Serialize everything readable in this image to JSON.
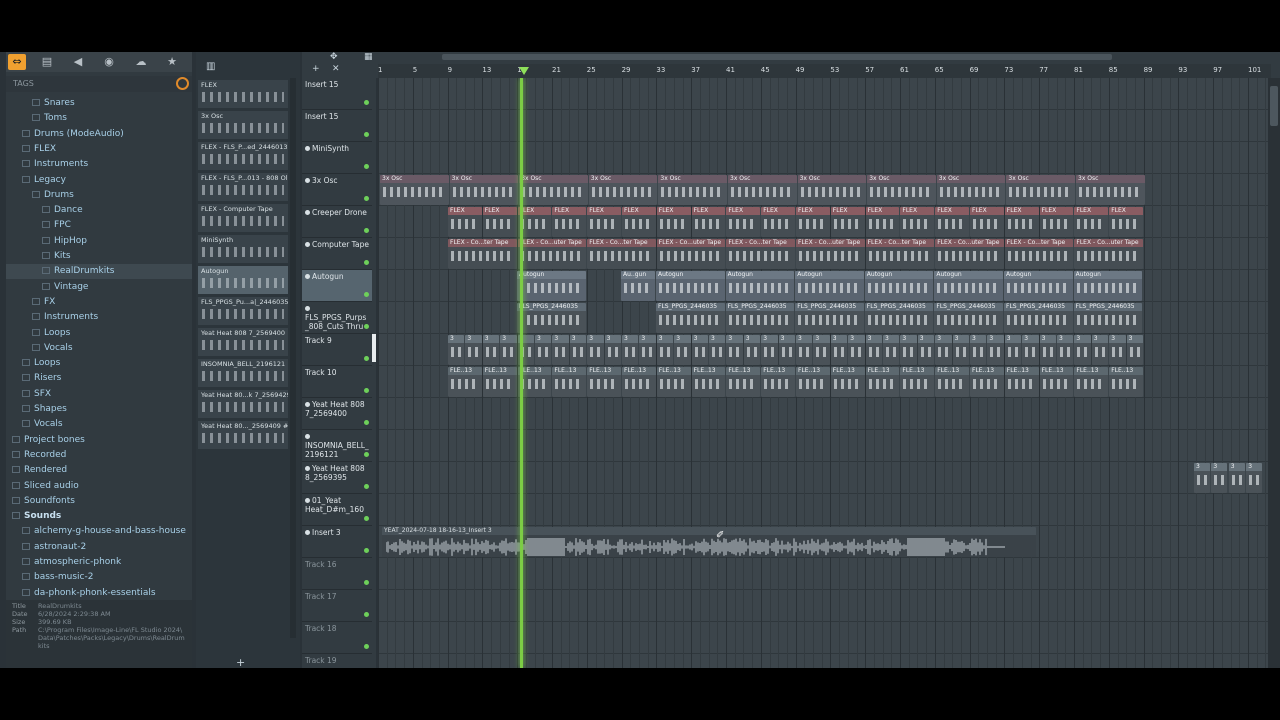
{
  "browser": {
    "toolbar_icons": [
      "arrows-icon",
      "file-icon",
      "speaker-icon",
      "plugin-icon",
      "cloud-icon",
      "star-icon"
    ],
    "tags_label": "TAGS",
    "tree": [
      {
        "label": "Snares",
        "indent": 2
      },
      {
        "label": "Toms",
        "indent": 2
      },
      {
        "label": "Drums (ModeAudio)",
        "indent": 1
      },
      {
        "label": "FLEX",
        "indent": 1
      },
      {
        "label": "Instruments",
        "indent": 1
      },
      {
        "label": "Legacy",
        "indent": 1
      },
      {
        "label": "Drums",
        "indent": 2
      },
      {
        "label": "Dance",
        "indent": 3
      },
      {
        "label": "FPC",
        "indent": 3
      },
      {
        "label": "HipHop",
        "indent": 3
      },
      {
        "label": "Kits",
        "indent": 3
      },
      {
        "label": "RealDrumkits",
        "indent": 3,
        "selected": true
      },
      {
        "label": "Vintage",
        "indent": 3
      },
      {
        "label": "FX",
        "indent": 2
      },
      {
        "label": "Instruments",
        "indent": 2
      },
      {
        "label": "Loops",
        "indent": 2
      },
      {
        "label": "Vocals",
        "indent": 2
      },
      {
        "label": "Loops",
        "indent": 1
      },
      {
        "label": "Risers",
        "indent": 1
      },
      {
        "label": "SFX",
        "indent": 1
      },
      {
        "label": "Shapes",
        "indent": 1
      },
      {
        "label": "Vocals",
        "indent": 1
      },
      {
        "label": "Project bones",
        "indent": 0
      },
      {
        "label": "Recorded",
        "indent": 0
      },
      {
        "label": "Rendered",
        "indent": 0
      },
      {
        "label": "Sliced audio",
        "indent": 0
      },
      {
        "label": "Soundfonts",
        "indent": 0
      },
      {
        "label": "Sounds",
        "indent": 0,
        "header": true
      },
      {
        "label": "alchemy-g-house-and-bass-house",
        "indent": 1
      },
      {
        "label": "astronaut-2",
        "indent": 1
      },
      {
        "label": "atmospheric-phonk",
        "indent": 1
      },
      {
        "label": "bass-music-2",
        "indent": 1
      },
      {
        "label": "da-phonk-phonk-essentials",
        "indent": 1
      }
    ],
    "info": {
      "title_k": "Title",
      "title_v": "RealDrumkits",
      "date_k": "Date",
      "date_v": "6/28/2024 2:29:38 AM",
      "size_k": "Size",
      "size_v": "399.69 KB",
      "path_k": "Path",
      "path_v1": "C:\\Program Files\\Image-Line\\FL Studio 2024\\",
      "path_v2": "Data\\Patches\\Packs\\Legacy\\Drums\\RealDrum",
      "path_v3": "kits"
    }
  },
  "picker": {
    "items": [
      "FLEX",
      "3x Osc",
      "FLEX - FLS_P...ed_2446013",
      "FLEX - FLS_P...013 - 808 Ol",
      "FLEX - Computer Tape",
      "MiniSynth",
      "Autogun",
      "FLS_PPGS_Pu...a|_2446035",
      "Yeat Heat 808 7_2569400",
      "INSOMNIA_BELL_2196121",
      "Yeat Heat 80...k 7_2569429",
      "Yeat Heat 80..._2569409 #4"
    ],
    "add_label": "+"
  },
  "ruler": {
    "labels": [
      "1",
      "5",
      "9",
      "13",
      "17",
      "21",
      "25",
      "29",
      "33",
      "37",
      "41",
      "45",
      "49",
      "53",
      "57",
      "61",
      "65",
      "69",
      "73",
      "77",
      "81",
      "85",
      "89",
      "93",
      "97",
      "101"
    ]
  },
  "tracks": [
    {
      "name": "Insert 15",
      "dim": false
    },
    {
      "name": "Insert 15",
      "dim": false
    },
    {
      "name": "MiniSynth",
      "dim": false,
      "mute": true
    },
    {
      "name": "3x Osc",
      "dim": false,
      "mute": true
    },
    {
      "name": "Creeper Drone",
      "dim": false,
      "mute": true
    },
    {
      "name": "Computer Tape",
      "dim": false,
      "mute": true
    },
    {
      "name": "Autogun",
      "dim": false,
      "mute": true,
      "selected": true
    },
    {
      "name": "FLS_PPGS_Purps _808_Cuts Thru",
      "dim": false,
      "mute": true
    },
    {
      "name": "Track 9",
      "dim": false
    },
    {
      "name": "Track 10",
      "dim": false
    },
    {
      "name": "Yeat Heat 808 7_2569400",
      "dim": false,
      "mute": true
    },
    {
      "name": "INSOMNIA_BELL_ 2196121",
      "dim": false,
      "mute": true
    },
    {
      "name": "Yeat Heat 808 8_2569395",
      "dim": false,
      "mute": true
    },
    {
      "name": "01_Yeat Heat_D#m_160",
      "dim": false,
      "mute": true
    },
    {
      "name": "Insert 3",
      "dim": false,
      "mute": true
    },
    {
      "name": "Track 16",
      "dim": true
    },
    {
      "name": "Track 17",
      "dim": true
    },
    {
      "name": "Track 18",
      "dim": true
    },
    {
      "name": "Track 19",
      "dim": true
    }
  ],
  "clip_labels": {
    "osc": "3x Osc",
    "flex": "FLEX",
    "tape_a": "FLEX - Co...ter Tape",
    "tape_b": "FLEX - Co...uter Tape",
    "auto": "Autogun",
    "auto_short": "Au..gun",
    "fls": "FLS_PPGS_2446035",
    "t9": "3",
    "t10": "FLE..13",
    "audio": "YEAT_2024-07-18 18-16-13_Insert 3"
  },
  "colors": {
    "accent": "#f0a030",
    "playhead": "#7ccd45",
    "tree_text": "#a8d0e8"
  }
}
